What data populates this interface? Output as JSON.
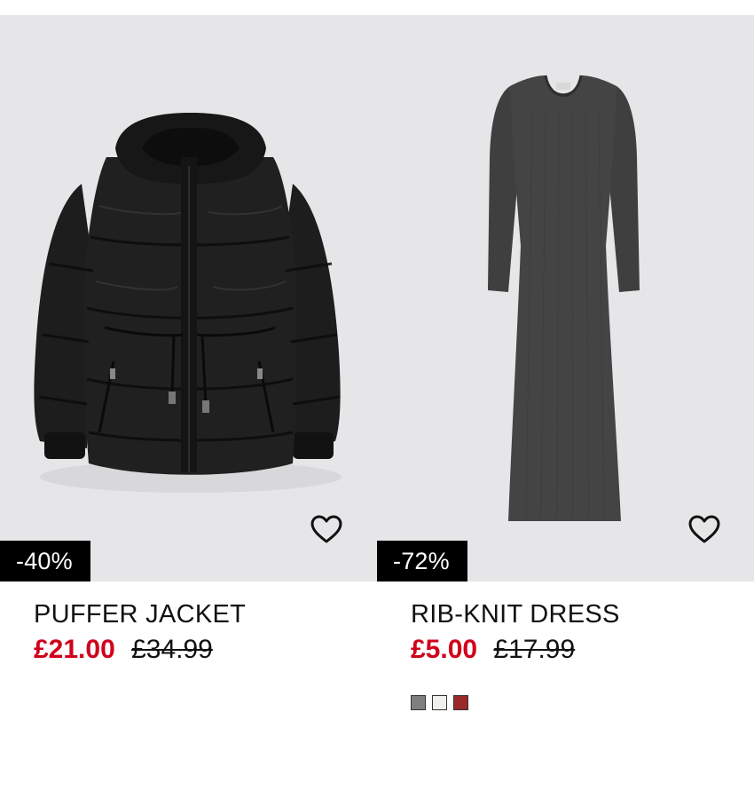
{
  "products": [
    {
      "name": "PUFFER JACKET",
      "sale_price": "£21.00",
      "original_price": "£34.99",
      "discount": "-40%",
      "colors": []
    },
    {
      "name": "RIB-KNIT DRESS",
      "sale_price": "£5.00",
      "original_price": "£17.99",
      "discount": "-72%",
      "colors": [
        "#7f7f7f",
        "#f2f0ec",
        "#9b2a2a"
      ]
    }
  ],
  "theme": {
    "sale_color": "#d0021b",
    "badge_bg": "#000000",
    "image_bg": "#e6e6e8"
  },
  "icons": {
    "favorite": "heart-outline-icon"
  }
}
